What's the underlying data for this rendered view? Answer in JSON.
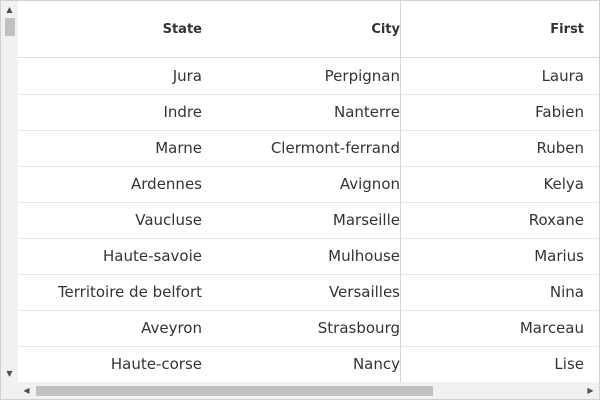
{
  "columns": {
    "state": "State",
    "city": "City",
    "first": "First"
  },
  "rows": [
    {
      "state": "Jura",
      "city": "Perpignan",
      "first": "Laura"
    },
    {
      "state": "Indre",
      "city": "Nanterre",
      "first": "Fabien"
    },
    {
      "state": "Marne",
      "city": "Clermont-ferrand",
      "first": "Ruben"
    },
    {
      "state": "Ardennes",
      "city": "Avignon",
      "first": "Kelya"
    },
    {
      "state": "Vaucluse",
      "city": "Marseille",
      "first": "Roxane"
    },
    {
      "state": "Haute-savoie",
      "city": "Mulhouse",
      "first": "Marius"
    },
    {
      "state": "Territoire de belfort",
      "city": "Versailles",
      "first": "Nina"
    },
    {
      "state": "Aveyron",
      "city": "Strasbourg",
      "first": "Marceau"
    },
    {
      "state": "Haute-corse",
      "city": "Nancy",
      "first": "Lise"
    }
  ],
  "icons": {
    "scroll_up": "▲",
    "scroll_down": "▼",
    "scroll_left": "◀",
    "scroll_right": "▶"
  }
}
